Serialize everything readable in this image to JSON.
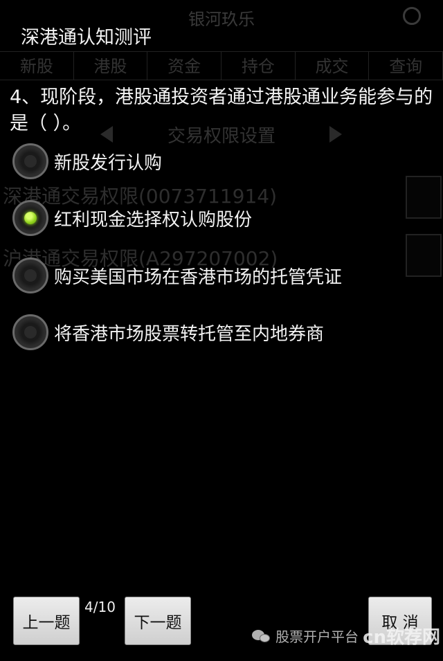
{
  "background_app": {
    "title": "银河玖乐",
    "tabs": [
      "新股",
      "港股",
      "资金",
      "持仓",
      "成交",
      "查询"
    ],
    "sub_title": "交易权限设置",
    "row1": "深港通交易权限(0073711914)",
    "row2": "沪港通交易权限(A297207002)"
  },
  "dialog": {
    "title": "深港通认知测评",
    "question": "4、现阶段，港股通投资者通过港股通业务能参与的是（  ）。",
    "options": [
      {
        "label": "新股发行认购",
        "checked": false
      },
      {
        "label": "红利现金选择权认购股份",
        "checked": true
      },
      {
        "label": "购买美国市场在香港市场的托管凭证",
        "checked": false
      },
      {
        "label": "将香港市场股票转托管至内地券商",
        "checked": false
      }
    ],
    "prev_label": "上一题",
    "next_label": "下一题",
    "progress": "4/10",
    "cancel_label": "取 消"
  },
  "watermark": {
    "text": "股票开户平台",
    "brand": "cn软荐网"
  },
  "colors": {
    "radio_checked": "#8fd11c",
    "button_bg": "#e0e0e0",
    "background": "#000000"
  }
}
